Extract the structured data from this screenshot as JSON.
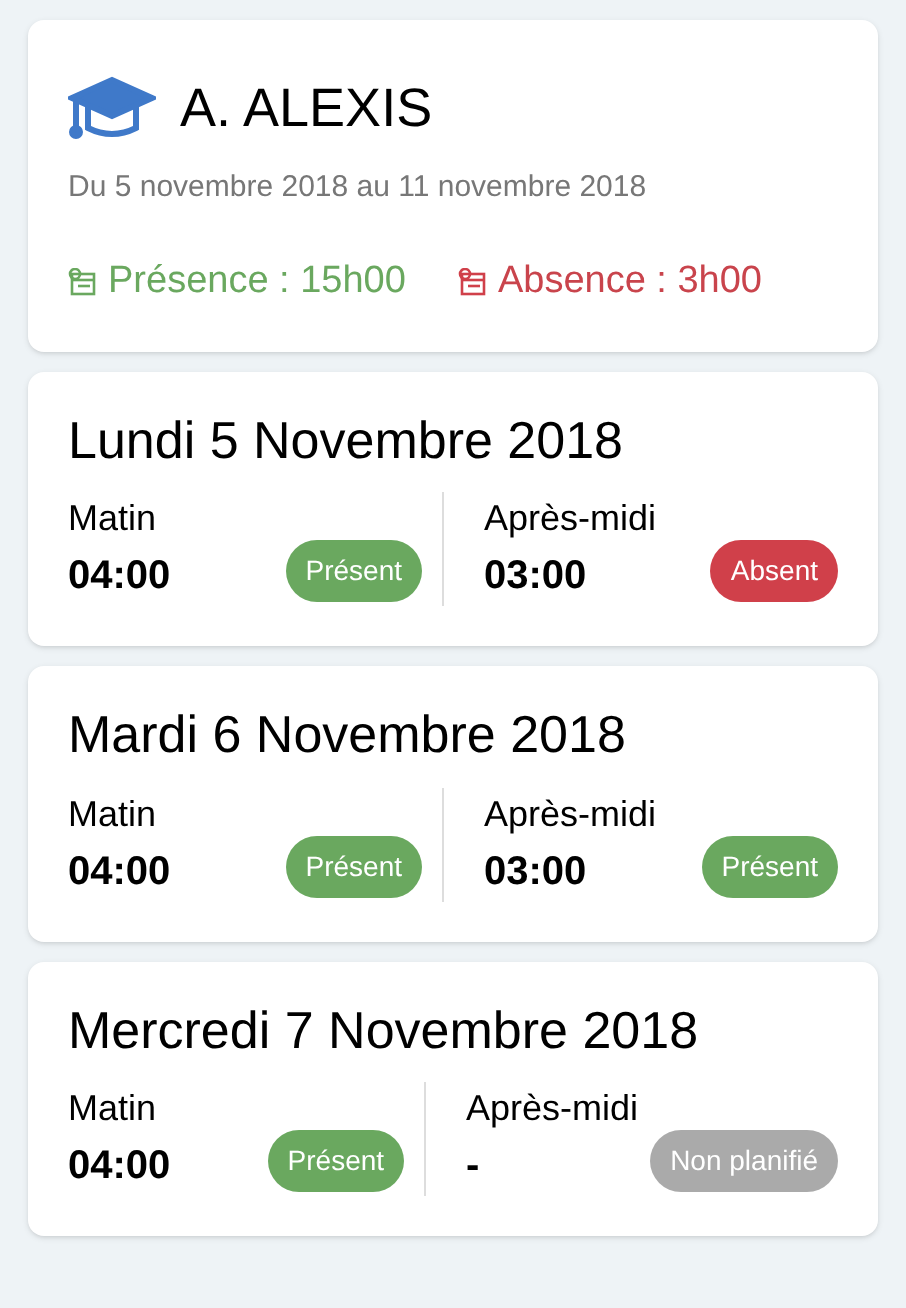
{
  "header": {
    "name": "A. ALEXIS",
    "period": "Du 5 novembre 2018 au 11 novembre 2018",
    "presence": "Présence : 15h00",
    "absence": "Absence : 3h00"
  },
  "days": [
    {
      "title": "Lundi 5 Novembre 2018",
      "slots": [
        {
          "label": "Matin",
          "time": "04:00",
          "kind": "present",
          "badge": "Présent"
        },
        {
          "label": "Après-midi",
          "time": "03:00",
          "kind": "absent",
          "badge": "Absent"
        }
      ]
    },
    {
      "title": "Mardi 6 Novembre 2018",
      "slots": [
        {
          "label": "Matin",
          "time": "04:00",
          "kind": "present",
          "badge": "Présent"
        },
        {
          "label": "Après-midi",
          "time": "03:00",
          "kind": "present",
          "badge": "Présent"
        }
      ]
    },
    {
      "title": "Mercredi 7 Novembre 2018",
      "slots": [
        {
          "label": "Matin",
          "time": "04:00",
          "kind": "present",
          "badge": "Présent"
        },
        {
          "label": "Après-midi",
          "time": "-",
          "kind": "unplanned",
          "badge": "Non planifié"
        }
      ]
    }
  ]
}
